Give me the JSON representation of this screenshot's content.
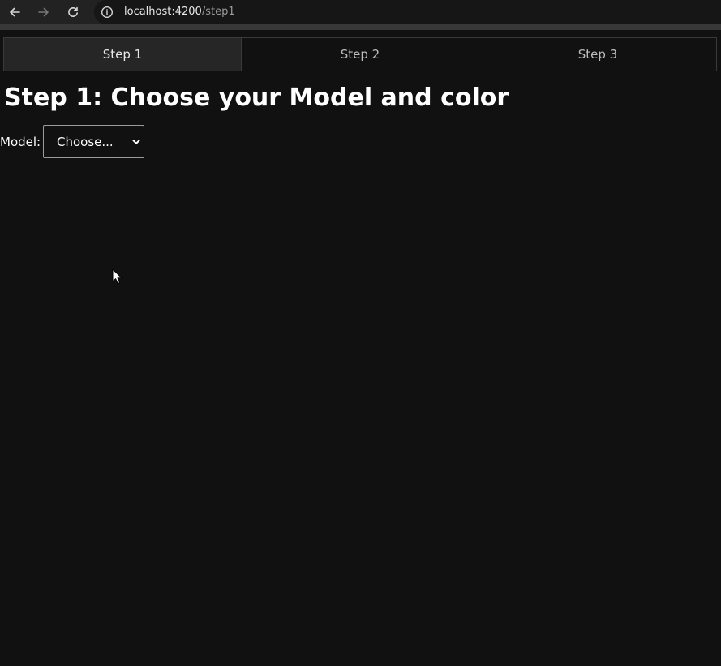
{
  "browser": {
    "url_host": "localhost:4200",
    "url_path": "/step1"
  },
  "tabs": [
    {
      "label": "Step 1",
      "active": true
    },
    {
      "label": "Step 2",
      "active": false
    },
    {
      "label": "Step 3",
      "active": false
    }
  ],
  "page": {
    "title": "Step 1: Choose your Model and color",
    "model_label": "Model:",
    "model_select_value": "Choose..."
  },
  "colors": {
    "background": "#111111",
    "active_tab": "#262626",
    "border": "#3a3a3a"
  }
}
